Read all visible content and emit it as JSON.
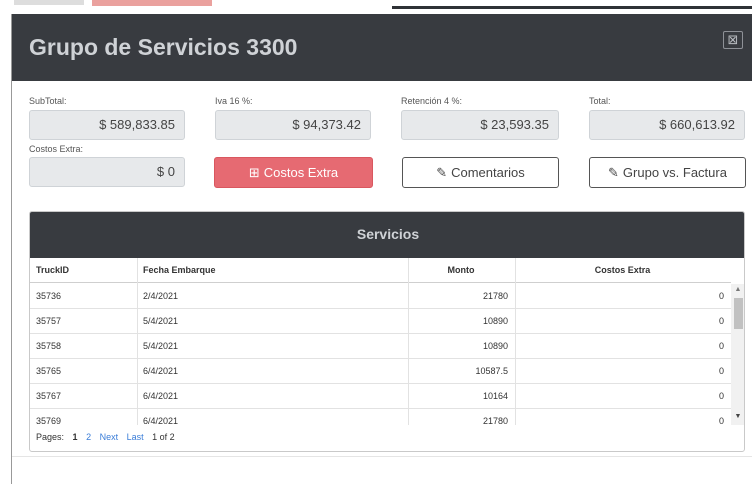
{
  "modal": {
    "title": "Grupo de Servicios 3300",
    "close_glyph": "⊠"
  },
  "fields": {
    "subtotal": {
      "label": "SubTotal:",
      "value": "$ 589,833.85"
    },
    "iva": {
      "label": "Iva 16 %:",
      "value": "$ 94,373.42"
    },
    "retencion": {
      "label": "Retención 4 %:",
      "value": "$ 23,593.35"
    },
    "total": {
      "label": "Total:",
      "value": "$ 660,613.92"
    },
    "costos_extra": {
      "label": "Costos Extra:",
      "value": "$ 0"
    }
  },
  "buttons": {
    "costos_extra": {
      "label": "Costos Extra",
      "icon": "plus-square-icon",
      "glyph": "⊞"
    },
    "comentarios": {
      "label": "Comentarios",
      "icon": "edit-icon",
      "glyph": "✎"
    },
    "grupo_factura": {
      "label": "Grupo vs. Factura",
      "icon": "edit-icon",
      "glyph": "✎"
    }
  },
  "servicios": {
    "title": "Servicios",
    "columns": [
      "TruckID",
      "Fecha Embarque",
      "Monto",
      "Costos Extra"
    ],
    "rows": [
      [
        "35736",
        "2/4/2021",
        "21780",
        "0"
      ],
      [
        "35757",
        "5/4/2021",
        "10890",
        "0"
      ],
      [
        "35758",
        "5/4/2021",
        "10890",
        "0"
      ],
      [
        "35765",
        "6/4/2021",
        "10587.5",
        "0"
      ],
      [
        "35767",
        "6/4/2021",
        "10164",
        "0"
      ],
      [
        "35769",
        "6/4/2021",
        "21780",
        "0"
      ]
    ],
    "pager": {
      "label": "Pages:",
      "current": "1",
      "page2": "2",
      "next": "Next",
      "last": "Last",
      "info": "1 of 2"
    }
  },
  "colors": {
    "header_bg": "#383b40",
    "danger": "#e66a72",
    "link": "#3a7dd8"
  }
}
